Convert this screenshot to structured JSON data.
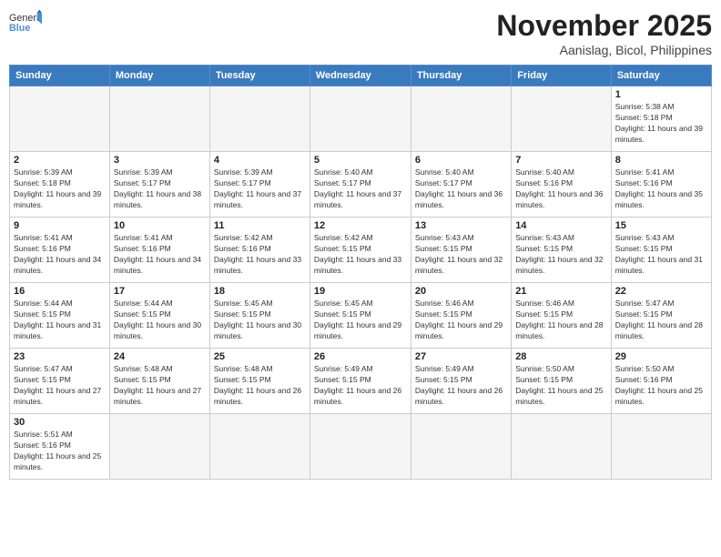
{
  "header": {
    "logo_general": "General",
    "logo_blue": "Blue",
    "month": "November 2025",
    "location": "Aanislag, Bicol, Philippines"
  },
  "weekdays": [
    "Sunday",
    "Monday",
    "Tuesday",
    "Wednesday",
    "Thursday",
    "Friday",
    "Saturday"
  ],
  "weeks": [
    [
      {
        "day": "",
        "sunrise": "",
        "sunset": "",
        "daylight": ""
      },
      {
        "day": "",
        "sunrise": "",
        "sunset": "",
        "daylight": ""
      },
      {
        "day": "",
        "sunrise": "",
        "sunset": "",
        "daylight": ""
      },
      {
        "day": "",
        "sunrise": "",
        "sunset": "",
        "daylight": ""
      },
      {
        "day": "",
        "sunrise": "",
        "sunset": "",
        "daylight": ""
      },
      {
        "day": "",
        "sunrise": "",
        "sunset": "",
        "daylight": ""
      },
      {
        "day": "1",
        "sunrise": "Sunrise: 5:38 AM",
        "sunset": "Sunset: 5:18 PM",
        "daylight": "Daylight: 11 hours and 39 minutes."
      }
    ],
    [
      {
        "day": "2",
        "sunrise": "Sunrise: 5:39 AM",
        "sunset": "Sunset: 5:18 PM",
        "daylight": "Daylight: 11 hours and 39 minutes."
      },
      {
        "day": "3",
        "sunrise": "Sunrise: 5:39 AM",
        "sunset": "Sunset: 5:17 PM",
        "daylight": "Daylight: 11 hours and 38 minutes."
      },
      {
        "day": "4",
        "sunrise": "Sunrise: 5:39 AM",
        "sunset": "Sunset: 5:17 PM",
        "daylight": "Daylight: 11 hours and 37 minutes."
      },
      {
        "day": "5",
        "sunrise": "Sunrise: 5:40 AM",
        "sunset": "Sunset: 5:17 PM",
        "daylight": "Daylight: 11 hours and 37 minutes."
      },
      {
        "day": "6",
        "sunrise": "Sunrise: 5:40 AM",
        "sunset": "Sunset: 5:17 PM",
        "daylight": "Daylight: 11 hours and 36 minutes."
      },
      {
        "day": "7",
        "sunrise": "Sunrise: 5:40 AM",
        "sunset": "Sunset: 5:16 PM",
        "daylight": "Daylight: 11 hours and 36 minutes."
      },
      {
        "day": "8",
        "sunrise": "Sunrise: 5:41 AM",
        "sunset": "Sunset: 5:16 PM",
        "daylight": "Daylight: 11 hours and 35 minutes."
      }
    ],
    [
      {
        "day": "9",
        "sunrise": "Sunrise: 5:41 AM",
        "sunset": "Sunset: 5:16 PM",
        "daylight": "Daylight: 11 hours and 34 minutes."
      },
      {
        "day": "10",
        "sunrise": "Sunrise: 5:41 AM",
        "sunset": "Sunset: 5:16 PM",
        "daylight": "Daylight: 11 hours and 34 minutes."
      },
      {
        "day": "11",
        "sunrise": "Sunrise: 5:42 AM",
        "sunset": "Sunset: 5:16 PM",
        "daylight": "Daylight: 11 hours and 33 minutes."
      },
      {
        "day": "12",
        "sunrise": "Sunrise: 5:42 AM",
        "sunset": "Sunset: 5:15 PM",
        "daylight": "Daylight: 11 hours and 33 minutes."
      },
      {
        "day": "13",
        "sunrise": "Sunrise: 5:43 AM",
        "sunset": "Sunset: 5:15 PM",
        "daylight": "Daylight: 11 hours and 32 minutes."
      },
      {
        "day": "14",
        "sunrise": "Sunrise: 5:43 AM",
        "sunset": "Sunset: 5:15 PM",
        "daylight": "Daylight: 11 hours and 32 minutes."
      },
      {
        "day": "15",
        "sunrise": "Sunrise: 5:43 AM",
        "sunset": "Sunset: 5:15 PM",
        "daylight": "Daylight: 11 hours and 31 minutes."
      }
    ],
    [
      {
        "day": "16",
        "sunrise": "Sunrise: 5:44 AM",
        "sunset": "Sunset: 5:15 PM",
        "daylight": "Daylight: 11 hours and 31 minutes."
      },
      {
        "day": "17",
        "sunrise": "Sunrise: 5:44 AM",
        "sunset": "Sunset: 5:15 PM",
        "daylight": "Daylight: 11 hours and 30 minutes."
      },
      {
        "day": "18",
        "sunrise": "Sunrise: 5:45 AM",
        "sunset": "Sunset: 5:15 PM",
        "daylight": "Daylight: 11 hours and 30 minutes."
      },
      {
        "day": "19",
        "sunrise": "Sunrise: 5:45 AM",
        "sunset": "Sunset: 5:15 PM",
        "daylight": "Daylight: 11 hours and 29 minutes."
      },
      {
        "day": "20",
        "sunrise": "Sunrise: 5:46 AM",
        "sunset": "Sunset: 5:15 PM",
        "daylight": "Daylight: 11 hours and 29 minutes."
      },
      {
        "day": "21",
        "sunrise": "Sunrise: 5:46 AM",
        "sunset": "Sunset: 5:15 PM",
        "daylight": "Daylight: 11 hours and 28 minutes."
      },
      {
        "day": "22",
        "sunrise": "Sunrise: 5:47 AM",
        "sunset": "Sunset: 5:15 PM",
        "daylight": "Daylight: 11 hours and 28 minutes."
      }
    ],
    [
      {
        "day": "23",
        "sunrise": "Sunrise: 5:47 AM",
        "sunset": "Sunset: 5:15 PM",
        "daylight": "Daylight: 11 hours and 27 minutes."
      },
      {
        "day": "24",
        "sunrise": "Sunrise: 5:48 AM",
        "sunset": "Sunset: 5:15 PM",
        "daylight": "Daylight: 11 hours and 27 minutes."
      },
      {
        "day": "25",
        "sunrise": "Sunrise: 5:48 AM",
        "sunset": "Sunset: 5:15 PM",
        "daylight": "Daylight: 11 hours and 26 minutes."
      },
      {
        "day": "26",
        "sunrise": "Sunrise: 5:49 AM",
        "sunset": "Sunset: 5:15 PM",
        "daylight": "Daylight: 11 hours and 26 minutes."
      },
      {
        "day": "27",
        "sunrise": "Sunrise: 5:49 AM",
        "sunset": "Sunset: 5:15 PM",
        "daylight": "Daylight: 11 hours and 26 minutes."
      },
      {
        "day": "28",
        "sunrise": "Sunrise: 5:50 AM",
        "sunset": "Sunset: 5:15 PM",
        "daylight": "Daylight: 11 hours and 25 minutes."
      },
      {
        "day": "29",
        "sunrise": "Sunrise: 5:50 AM",
        "sunset": "Sunset: 5:16 PM",
        "daylight": "Daylight: 11 hours and 25 minutes."
      }
    ],
    [
      {
        "day": "30",
        "sunrise": "Sunrise: 5:51 AM",
        "sunset": "Sunset: 5:16 PM",
        "daylight": "Daylight: 11 hours and 25 minutes."
      },
      {
        "day": "",
        "sunrise": "",
        "sunset": "",
        "daylight": ""
      },
      {
        "day": "",
        "sunrise": "",
        "sunset": "",
        "daylight": ""
      },
      {
        "day": "",
        "sunrise": "",
        "sunset": "",
        "daylight": ""
      },
      {
        "day": "",
        "sunrise": "",
        "sunset": "",
        "daylight": ""
      },
      {
        "day": "",
        "sunrise": "",
        "sunset": "",
        "daylight": ""
      },
      {
        "day": "",
        "sunrise": "",
        "sunset": "",
        "daylight": ""
      }
    ]
  ]
}
